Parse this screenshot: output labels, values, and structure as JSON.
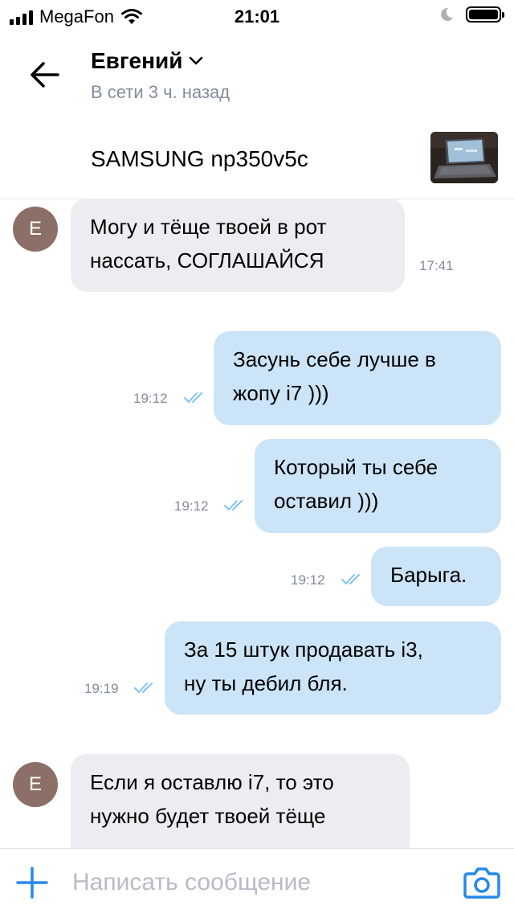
{
  "status_bar": {
    "carrier": "MegaFon",
    "time": "21:01"
  },
  "header": {
    "name": "Евгений",
    "status": "В сети 3 ч. назад"
  },
  "product": {
    "title": "SAMSUNG np350v5c"
  },
  "messages": [
    {
      "direction": "in",
      "avatar_letter": "E",
      "lines": [
        "Могу и тёще твоей в рот",
        "нассать, СОГЛАШАЙСЯ"
      ],
      "time": "17:41"
    },
    {
      "direction": "out",
      "lines": [
        "Засунь себе лучше в",
        "жопу i7 )))"
      ],
      "time": "19:12",
      "read": true
    },
    {
      "direction": "out",
      "lines": [
        "Который ты себе",
        "оставил )))"
      ],
      "time": "19:12",
      "read": true
    },
    {
      "direction": "out",
      "lines": [
        "Барыга."
      ],
      "time": "19:12",
      "read": true
    },
    {
      "direction": "out",
      "lines": [
        "За 15 штук продавать i3,",
        "ну ты дебил бля."
      ],
      "time": "19:19",
      "read": true
    },
    {
      "direction": "in",
      "avatar_letter": "E",
      "lines": [
        "Если я оставлю i7, то это",
        "нужно будет твоей тёще"
      ],
      "time": ""
    }
  ],
  "composer": {
    "placeholder": "Написать сообщение"
  },
  "colors": {
    "accent": "#2688eb",
    "outgoing_bubble": "#cce4f7",
    "incoming_bubble": "#ebedf0",
    "avatar": "#8c6f66",
    "read_ticks": "#7ec4f0"
  },
  "icons": [
    "signal-icon",
    "wifi-icon",
    "moon-icon",
    "battery-icon",
    "back-arrow-icon",
    "chevron-down-icon",
    "read-ticks-icon",
    "plus-icon",
    "camera-icon"
  ]
}
